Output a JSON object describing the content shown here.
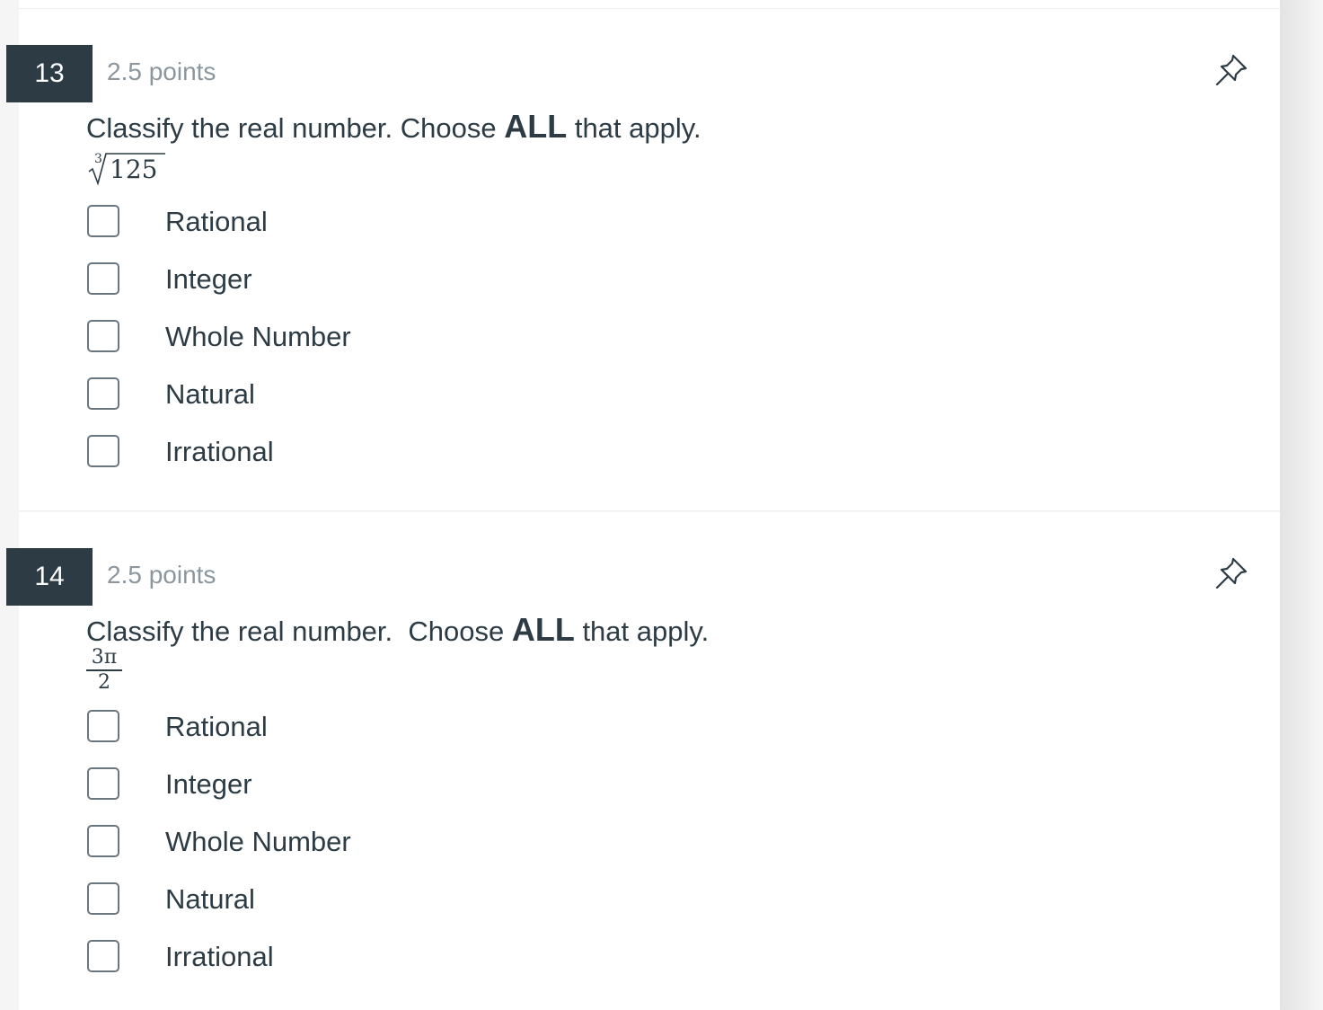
{
  "colors": {
    "qnum_bg": "#2d3b45",
    "text": "#2d3b45",
    "muted": "#8b969e",
    "checkbox_border": "#6b7780"
  },
  "questions": [
    {
      "number": "13",
      "points": "2.5 points",
      "prompt_pre": "Classify the real number. Choose ",
      "prompt_bold": "ALL",
      "prompt_post": " that apply.",
      "math": {
        "type": "cube-root",
        "index": "3",
        "radicand": "125"
      },
      "options": [
        "Rational",
        "Integer",
        "Whole Number",
        "Natural",
        "Irrational"
      ],
      "pin_icon": "pin-icon"
    },
    {
      "number": "14",
      "points": "2.5 points",
      "prompt_pre": "Classify the real number.  Choose ",
      "prompt_bold": "ALL",
      "prompt_post": " that apply.",
      "math": {
        "type": "fraction",
        "numerator": "3π",
        "denominator": "2"
      },
      "options": [
        "Rational",
        "Integer",
        "Whole Number",
        "Natural",
        "Irrational"
      ],
      "pin_icon": "pin-icon"
    }
  ]
}
